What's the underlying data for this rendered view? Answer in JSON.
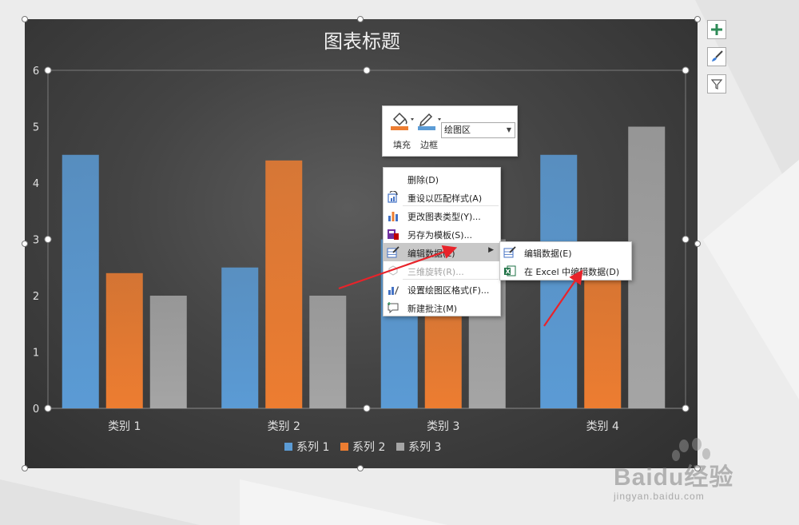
{
  "chart_data": {
    "type": "bar",
    "title": "图表标题",
    "categories": [
      "类别 1",
      "类别 2",
      "类别 3",
      "类别 4"
    ],
    "series": [
      {
        "name": "系列 1",
        "color": "#5b9bd5",
        "values": [
          4.5,
          2.5,
          3.0,
          4.5
        ]
      },
      {
        "name": "系列 2",
        "color": "#ed7d31",
        "values": [
          2.4,
          4.4,
          2.0,
          2.8
        ]
      },
      {
        "name": "系列 3",
        "color": "#a5a5a5",
        "values": [
          2.0,
          2.0,
          3.0,
          5.0
        ]
      }
    ],
    "ylim": [
      0,
      6
    ],
    "yticks": [
      "0",
      "1",
      "2",
      "3",
      "4",
      "5",
      "6"
    ],
    "grid": false,
    "legend": "bottom"
  },
  "format_toolbar": {
    "fill_label": "填充",
    "border_label": "边框",
    "area_select_value": "绘图区"
  },
  "context_menu": {
    "items": [
      {
        "label": "删除(D)",
        "icon": "none",
        "disabled": false
      },
      {
        "label": "重设以匹配样式(A)",
        "icon": "reset-style-icon",
        "disabled": false
      },
      {
        "label": "更改图表类型(Y)...",
        "icon": "chart-type-icon",
        "disabled": false
      },
      {
        "label": "另存为模板(S)...",
        "icon": "save-template-icon",
        "disabled": false
      },
      {
        "label": "编辑数据(E)",
        "icon": "edit-data-icon",
        "disabled": false,
        "has_submenu": true
      },
      {
        "label": "三维旋转(R)...",
        "icon": "rotate-3d-icon",
        "disabled": true
      },
      {
        "label": "设置绘图区格式(F)...",
        "icon": "format-area-icon",
        "disabled": false
      },
      {
        "label": "新建批注(M)",
        "icon": "comment-icon",
        "disabled": false
      }
    ]
  },
  "submenu": {
    "items": [
      {
        "label": "编辑数据(E)",
        "icon": "edit-data-icon"
      },
      {
        "label": "在 Excel 中编辑数据(D)",
        "icon": "excel-icon"
      }
    ]
  },
  "side_buttons": [
    "add-chart-element-icon",
    "chart-style-brush-icon",
    "chart-filter-icon"
  ],
  "colors": {
    "annotation_arrow": "#e8232a"
  },
  "watermark": {
    "logo": "Baidu经验",
    "url": "jingyan.baidu.com"
  }
}
